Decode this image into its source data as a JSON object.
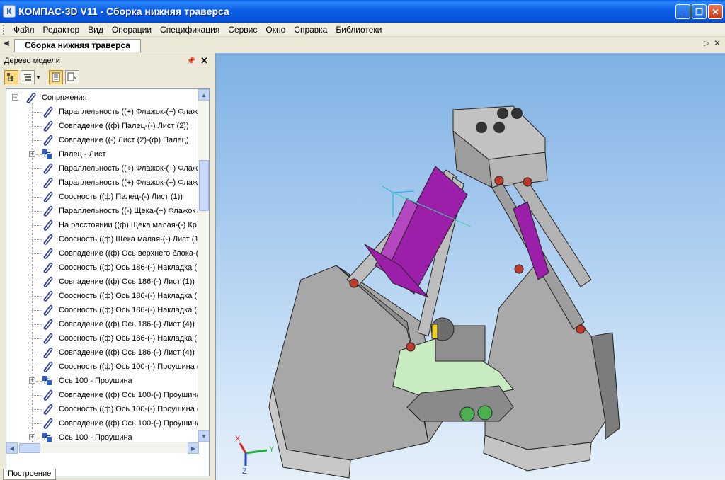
{
  "window": {
    "title": "КОМПАС-3D V11 - Сборка нижняя траверса",
    "app_icon": "kompas-icon"
  },
  "menu": [
    "Файл",
    "Редактор",
    "Вид",
    "Операции",
    "Спецификация",
    "Сервис",
    "Окно",
    "Справка",
    "Библиотеки"
  ],
  "document_tab": "Сборка нижняя траверса",
  "model_tree": {
    "title": "Дерево модели",
    "rows": [
      {
        "label": "Сопряжения",
        "type": "folder",
        "expander": "−"
      },
      {
        "label": "Параллельность ((+) Флажок-(+) Флажок",
        "type": "mate"
      },
      {
        "label": "Совпадение ((ф) Палец-(-) Лист (2))",
        "type": "mate"
      },
      {
        "label": "Совпадение ((-) Лист (2)-(ф) Палец)",
        "type": "mate"
      },
      {
        "label": "Палец - Лист",
        "type": "group",
        "expander": "+"
      },
      {
        "label": "Параллельность ((+) Флажок-(+) Флажок",
        "type": "mate"
      },
      {
        "label": "Параллельность ((+) Флажок-(+) Флажок",
        "type": "mate"
      },
      {
        "label": "Соосность ((ф) Палец-(-) Лист (1))",
        "type": "mate"
      },
      {
        "label": "Параллельность ((-) Щека-(+) Флажок",
        "type": "mate"
      },
      {
        "label": "На расстоянии ((ф) Щека малая-(-) Кр",
        "type": "mate"
      },
      {
        "label": "Соосность ((ф) Щека малая-(-) Лист (1",
        "type": "mate"
      },
      {
        "label": "Совпадение ((ф) Ось верхнего блока-(",
        "type": "mate"
      },
      {
        "label": "Соосность ((ф) Ось 186-(-) Накладка (",
        "type": "mate"
      },
      {
        "label": "Совпадение ((ф) Ось 186-(-) Лист (1))",
        "type": "mate"
      },
      {
        "label": "Соосность ((ф) Ось 186-(-) Накладка (",
        "type": "mate"
      },
      {
        "label": "Соосность ((ф) Ось 186-(-) Накладка (",
        "type": "mate"
      },
      {
        "label": "Совпадение ((ф) Ось 186-(-) Лист (4))",
        "type": "mate"
      },
      {
        "label": "Соосность ((ф) Ось 186-(-) Накладка (",
        "type": "mate"
      },
      {
        "label": "Совпадение ((ф) Ось 186-(-) Лист (4))",
        "type": "mate"
      },
      {
        "label": "Соосность ((ф) Ось 100-(-) Проушина (",
        "type": "mate"
      },
      {
        "label": "Ось 100 - Проушина",
        "type": "group",
        "expander": "+"
      },
      {
        "label": "Совпадение ((ф) Ось 100-(-) Проушина",
        "type": "mate"
      },
      {
        "label": "Соосность ((ф) Ось 100-(-) Проушина (",
        "type": "mate"
      },
      {
        "label": "Совпадение ((ф) Ось 100-(-) Проушина",
        "type": "mate"
      },
      {
        "label": "Ось 100 - Проушина",
        "type": "group",
        "expander": "+"
      }
    ]
  },
  "bottom_tab": "Построение",
  "axes": {
    "x": "X",
    "y": "Y",
    "z": "Z"
  },
  "colors": {
    "title_bar": "#0c5fe6",
    "viewport_top": "#7fb1e3",
    "viewport_bottom": "#e4eff9",
    "part_gray": "#9a9a9a",
    "part_purple": "#9b1fa8",
    "part_green": "#c8ecc0"
  }
}
